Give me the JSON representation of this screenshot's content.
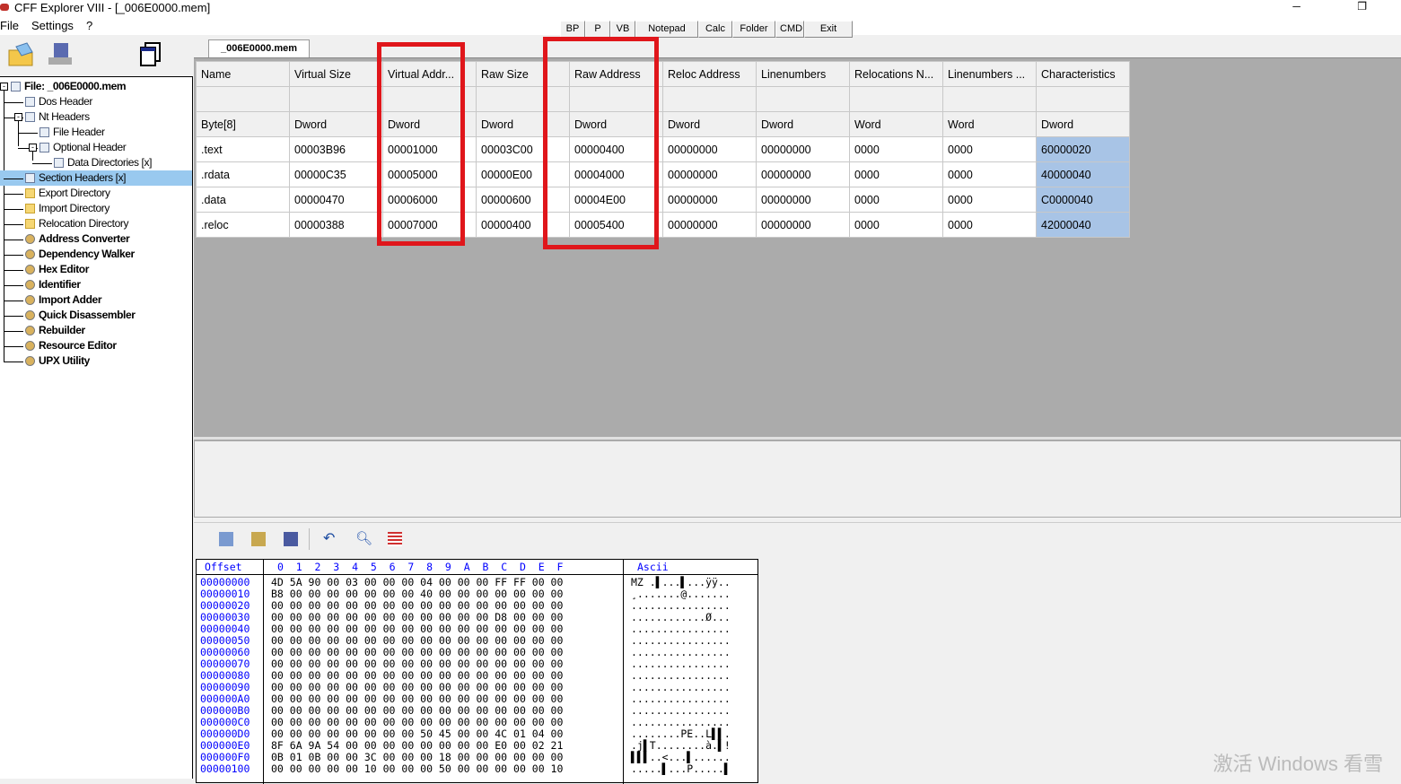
{
  "window": {
    "title": "CFF Explorer VIII - [_006E0000.mem]",
    "controls": "─ ❐"
  },
  "menu": [
    "File",
    "Settings",
    "?"
  ],
  "toolbar_buttons": [
    "BP",
    "P",
    "VB",
    "Notepad",
    "Calc",
    "Folder",
    "CMD",
    "Exit"
  ],
  "tree": {
    "root": "File: _006E0000.mem",
    "items": [
      {
        "label": "Dos Header",
        "icon": "page-icon"
      },
      {
        "label": "Nt Headers",
        "icon": "page-icon"
      },
      {
        "label": "File Header",
        "icon": "page-icon"
      },
      {
        "label": "Optional Header",
        "icon": "page-icon"
      },
      {
        "label": "Data Directories [x]",
        "icon": "page-icon"
      },
      {
        "label": "Section Headers [x]",
        "icon": "page-icon",
        "selected": true
      },
      {
        "label": "Export Directory",
        "icon": "folder-icon"
      },
      {
        "label": "Import Directory",
        "icon": "folder-icon"
      },
      {
        "label": "Relocation Directory",
        "icon": "folder-icon"
      },
      {
        "label": "Address Converter",
        "icon": "tool-icon"
      },
      {
        "label": "Dependency Walker",
        "icon": "tool-icon"
      },
      {
        "label": "Hex Editor",
        "icon": "tool-icon"
      },
      {
        "label": "Identifier",
        "icon": "tool-icon"
      },
      {
        "label": "Import Adder",
        "icon": "tool-icon"
      },
      {
        "label": "Quick Disassembler",
        "icon": "tool-icon"
      },
      {
        "label": "Rebuilder",
        "icon": "tool-icon"
      },
      {
        "label": "Resource Editor",
        "icon": "tool-icon"
      },
      {
        "label": "UPX Utility",
        "icon": "tool-icon"
      }
    ]
  },
  "tab": "_006E0000.mem",
  "sections": {
    "columns": [
      "Name",
      "Virtual Size",
      "Virtual Addr...",
      "Raw Size",
      "Raw Address",
      "Reloc Address",
      "Linenumbers",
      "Relocations N...",
      "Linenumbers ...",
      "Characteristics"
    ],
    "types": [
      "Byte[8]",
      "Dword",
      "Dword",
      "Dword",
      "Dword",
      "Dword",
      "Dword",
      "Word",
      "Word",
      "Dword"
    ],
    "rows": [
      [
        ".text",
        "00003B96",
        "00001000",
        "00003C00",
        "00000400",
        "00000000",
        "00000000",
        "0000",
        "0000",
        "60000020"
      ],
      [
        ".rdata",
        "00000C35",
        "00005000",
        "00000E00",
        "00004000",
        "00000000",
        "00000000",
        "0000",
        "0000",
        "40000040"
      ],
      [
        ".data",
        "00000470",
        "00006000",
        "00000600",
        "00004E00",
        "00000000",
        "00000000",
        "0000",
        "0000",
        "C0000040"
      ],
      [
        ".reloc",
        "00000388",
        "00007000",
        "00000400",
        "00005400",
        "00000000",
        "00000000",
        "0000",
        "0000",
        "42000040"
      ]
    ]
  },
  "highlight_color": "#e0161b",
  "hex": {
    "header_offset": "Offset",
    "header_cols": "0  1  2  3  4  5  6  7  8  9  A  B  C  D  E  F",
    "header_ascii": "Ascii",
    "rows": [
      {
        "off": "00000000",
        "bytes": "4D 5A 90 00 03 00 00 00 04 00 00 00 FF FF 00 00",
        "ascii": "MZ .▌...▌...ÿÿ.."
      },
      {
        "off": "00000010",
        "bytes": "B8 00 00 00 00 00 00 00 40 00 00 00 00 00 00 00",
        "ascii": "¸.......@......."
      },
      {
        "off": "00000020",
        "bytes": "00 00 00 00 00 00 00 00 00 00 00 00 00 00 00 00",
        "ascii": "................"
      },
      {
        "off": "00000030",
        "bytes": "00 00 00 00 00 00 00 00 00 00 00 00 D8 00 00 00",
        "ascii": "............Ø..."
      },
      {
        "off": "00000040",
        "bytes": "00 00 00 00 00 00 00 00 00 00 00 00 00 00 00 00",
        "ascii": "................"
      },
      {
        "off": "00000050",
        "bytes": "00 00 00 00 00 00 00 00 00 00 00 00 00 00 00 00",
        "ascii": "................"
      },
      {
        "off": "00000060",
        "bytes": "00 00 00 00 00 00 00 00 00 00 00 00 00 00 00 00",
        "ascii": "................"
      },
      {
        "off": "00000070",
        "bytes": "00 00 00 00 00 00 00 00 00 00 00 00 00 00 00 00",
        "ascii": "................"
      },
      {
        "off": "00000080",
        "bytes": "00 00 00 00 00 00 00 00 00 00 00 00 00 00 00 00",
        "ascii": "................"
      },
      {
        "off": "00000090",
        "bytes": "00 00 00 00 00 00 00 00 00 00 00 00 00 00 00 00",
        "ascii": "................"
      },
      {
        "off": "000000A0",
        "bytes": "00 00 00 00 00 00 00 00 00 00 00 00 00 00 00 00",
        "ascii": "................"
      },
      {
        "off": "000000B0",
        "bytes": "00 00 00 00 00 00 00 00 00 00 00 00 00 00 00 00",
        "ascii": "................"
      },
      {
        "off": "000000C0",
        "bytes": "00 00 00 00 00 00 00 00 00 00 00 00 00 00 00 00",
        "ascii": "................"
      },
      {
        "off": "000000D0",
        "bytes": "00 00 00 00 00 00 00 00 50 45 00 00 4C 01 04 00",
        "ascii": "........PE..L▌▌."
      },
      {
        "off": "000000E0",
        "bytes": "8F 6A 9A 54 00 00 00 00 00 00 00 00 E0 00 02 21",
        "ascii": ".j▌T........à.▌!"
      },
      {
        "off": "000000F0",
        "bytes": "0B 01 0B 00 00 3C 00 00 00 18 00 00 00 00 00 00",
        "ascii": "▌▌▌..<...▌......"
      },
      {
        "off": "00000100",
        "bytes": "00 00 00 00 00 10 00 00 00 50 00 00 00 00 00 10",
        "ascii": ".....▌...P.....▌"
      }
    ]
  },
  "watermark": "激活 Windows  看雪"
}
